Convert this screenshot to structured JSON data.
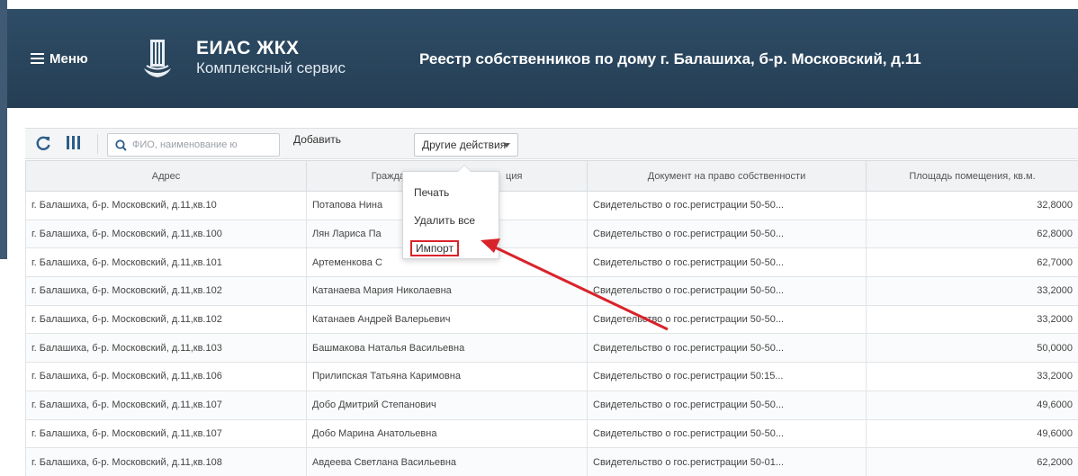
{
  "header": {
    "menu_label": "Меню",
    "brand_title": "ЕИАС ЖКХ",
    "brand_subtitle": "Комплексный сервис",
    "page_title": "Реестр собственников по дому г. Балашиха, б-р. Московский, д.11",
    "background": "#2b4860"
  },
  "toolbar": {
    "search_placeholder": "ФИО, наименование ю",
    "add_label": "Добавить",
    "other_actions_label": "Другие действия",
    "refresh_icon": "refresh-icon",
    "columns_icon": "columns-icon"
  },
  "dropdown": {
    "items": [
      "Печать",
      "Удалить все",
      "Импорт"
    ],
    "highlighted": "Импорт",
    "highlight_color": "#d9232a"
  },
  "table": {
    "headers": [
      "Адрес",
      "Гражданин/Организация",
      "Документ на право собственности",
      "Площадь помещения, кв.м."
    ],
    "header_hidden_part": "Гражда",
    "header_tail": "ция",
    "rows": [
      [
        "г. Балашиха, б-р. Московский, д.11,кв.10",
        "Потапова Нина",
        "Свидетельство о гос.регистрации 50-50...",
        "32,8000"
      ],
      [
        "г. Балашиха, б-р. Московский, д.11,кв.100",
        "Лян Лариса Па",
        "Свидетельство о гос.регистрации 50-50...",
        "62,8000"
      ],
      [
        "г. Балашиха, б-р. Московский, д.11,кв.101",
        "Артеменкова С",
        "Свидетельство о гос.регистрации 50-50...",
        "62,7000"
      ],
      [
        "г. Балашиха, б-р. Московский, д.11,кв.102",
        "Катанаева Мария Николаевна",
        "Свидетельство о гос.регистрации 50-50...",
        "33,2000"
      ],
      [
        "г. Балашиха, б-р. Московский, д.11,кв.102",
        "Катанаев Андрей Валерьевич",
        "Свидетельство о гос.регистрации 50-50...",
        "33,2000"
      ],
      [
        "г. Балашиха, б-р. Московский, д.11,кв.103",
        "Башмакова Наталья Васильевна",
        "Свидетельство о гос.регистрации 50-50...",
        "50,0000"
      ],
      [
        "г. Балашиха, б-р. Московский, д.11,кв.106",
        "Прилипская Татьяна Каримовна",
        "Свидетельство о гос.регистрации 50:15...",
        "33,2000"
      ],
      [
        "г. Балашиха, б-р. Московский, д.11,кв.107",
        "Добо Дмитрий Степанович",
        "Свидетельство о гос.регистрации 50-50...",
        "49,6000"
      ],
      [
        "г. Балашиха, б-р. Московский, д.11,кв.107",
        "Добо Марина Анатольевна",
        "Свидетельство о гос.регистрации 50-50...",
        "49,6000"
      ],
      [
        "г. Балашиха, б-р. Московский, д.11,кв.108",
        "Авдеева Светлана Васильевна",
        "Свидетельство о гос.регистрации 50-01...",
        "62,2000"
      ]
    ],
    "row3_name_tail": "вна"
  }
}
